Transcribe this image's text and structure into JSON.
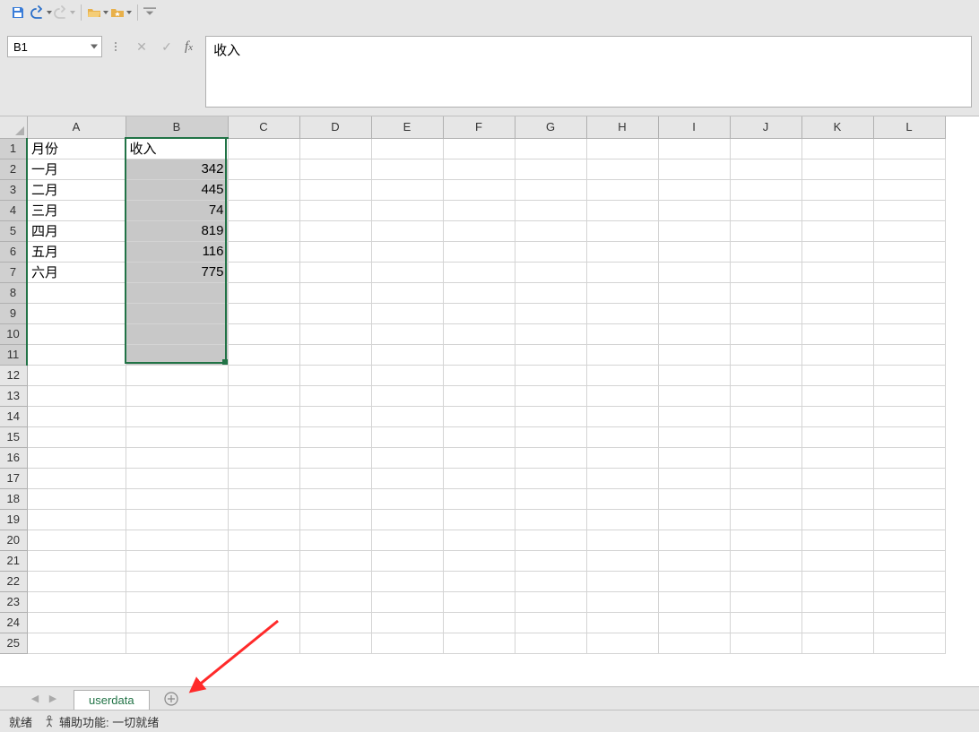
{
  "qat": {
    "save": "save",
    "undo": "undo",
    "redo": "redo",
    "open": "open",
    "favorite": "favorite"
  },
  "name_box": "B1",
  "formula_bar_value": "收入",
  "columns": [
    "A",
    "B",
    "C",
    "D",
    "E",
    "F",
    "G",
    "H",
    "I",
    "J",
    "K",
    "L"
  ],
  "rows": [
    1,
    2,
    3,
    4,
    5,
    6,
    7,
    8,
    9,
    10,
    11,
    12,
    13,
    14,
    15,
    16,
    17,
    18,
    19,
    20,
    21,
    22,
    23,
    24,
    25
  ],
  "data": {
    "A1": "月份",
    "B1": "收入",
    "A2": "一月",
    "B2": 342,
    "A3": "二月",
    "B3": 445,
    "A4": "三月",
    "B4": 74,
    "A5": "四月",
    "B5": 819,
    "A6": "五月",
    "B6": 116,
    "A7": "六月",
    "B7": 775
  },
  "selection": {
    "col": "B",
    "row_start": 1,
    "row_end": 11
  },
  "sheet_tab": "userdata",
  "status": {
    "ready": "就绪",
    "accessibility": "辅助功能: 一切就绪"
  }
}
